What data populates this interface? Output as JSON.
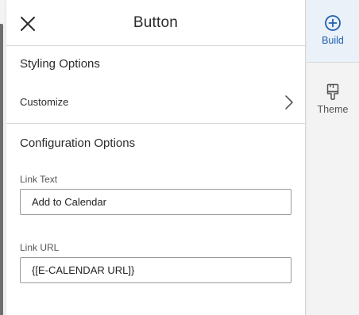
{
  "panel": {
    "title": "Button",
    "close_icon": "close-icon"
  },
  "styling": {
    "section_title": "Styling Options",
    "customize_label": "Customize",
    "customize_icon": "chevron-right-icon"
  },
  "configuration": {
    "section_title": "Configuration Options",
    "fields": [
      {
        "label": "Link Text",
        "value": "Add to Calendar"
      },
      {
        "label": "Link URL",
        "value": "{[E-CALENDAR URL]}"
      }
    ]
  },
  "rail": {
    "items": [
      {
        "label": "Build",
        "icon": "plus-circle-icon",
        "active": true
      },
      {
        "label": "Theme",
        "icon": "paintbrush-icon",
        "active": false
      }
    ]
  },
  "colors": {
    "accent": "#1f5faf",
    "active_bg": "#eaf1f9",
    "divider": "#d9d9d9"
  }
}
